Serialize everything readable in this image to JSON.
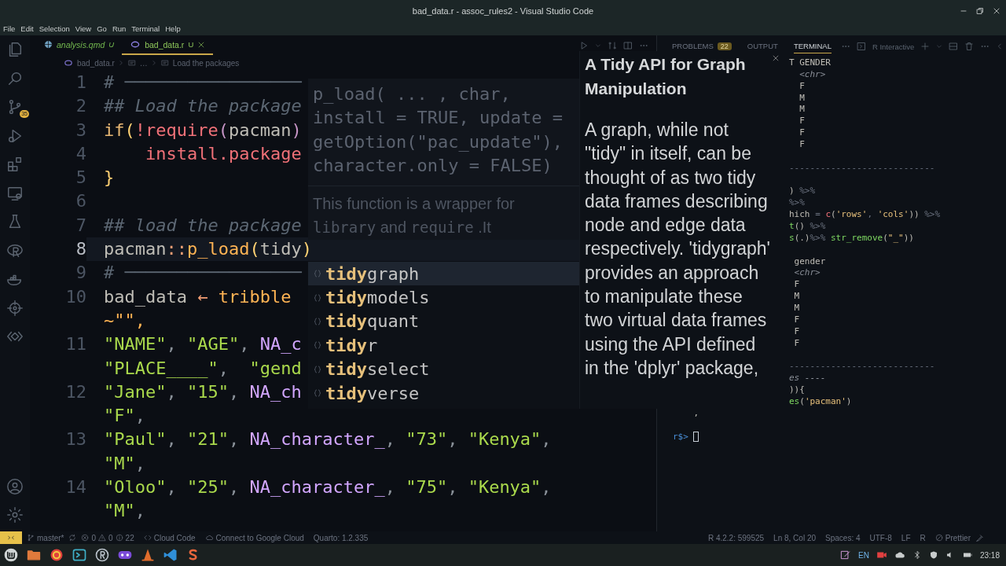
{
  "window": {
    "title": "bad_data.r - assoc_rules2 - Visual Studio Code"
  },
  "menu": [
    "File",
    "Edit",
    "Selection",
    "View",
    "Go",
    "Run",
    "Terminal",
    "Help"
  ],
  "activity_bar": {
    "badge": "35"
  },
  "editor": {
    "tabs": [
      {
        "label": "analysis.qmd",
        "status": "U",
        "selected": false
      },
      {
        "label": "bad_data.r",
        "status": "U",
        "selected": true
      }
    ],
    "breadcrumb": [
      "bad_data.r",
      "…",
      "Load the packages"
    ],
    "lines": [
      {
        "number": "1",
        "current": false,
        "rows": [
          {
            "kind": "code",
            "tokens": [
              {
                "text": "# ─────────────────",
                "kind": "comment"
              }
            ]
          }
        ]
      },
      {
        "number": "2",
        "current": false,
        "rows": [
          {
            "kind": "code",
            "tokens": [
              {
                "text": "## Load the package",
                "kind": "comment"
              }
            ]
          }
        ]
      },
      {
        "number": "3",
        "current": false,
        "rows": [
          {
            "kind": "code",
            "tokens": [
              {
                "text": "if",
                "kind": "keyword"
              },
              {
                "text": "(",
                "kind": "paren"
              },
              {
                "text": "!require",
                "kind": "call"
              },
              {
                "text": "(",
                "kind": "paren2"
              },
              {
                "text": "pacman",
                "kind": "plain"
              },
              {
                "text": ")",
                "kind": "paren2"
              }
            ]
          }
        ]
      },
      {
        "number": "4",
        "current": false,
        "rows": [
          {
            "kind": "code",
            "tokens": [
              {
                "text": "    install.package",
                "kind": "call"
              }
            ]
          }
        ]
      },
      {
        "number": "5",
        "current": false,
        "rows": [
          {
            "kind": "code",
            "tokens": [
              {
                "text": "}",
                "kind": "paren"
              }
            ]
          }
        ]
      },
      {
        "number": "6",
        "current": false,
        "rows": [
          {
            "kind": "blank"
          }
        ]
      },
      {
        "number": "7",
        "current": false,
        "rows": [
          {
            "kind": "code",
            "tokens": [
              {
                "text": "## load the package",
                "kind": "comment"
              }
            ]
          }
        ]
      },
      {
        "number": "8",
        "current": true,
        "rows": [
          {
            "kind": "code",
            "tokens": [
              {
                "text": "pacman",
                "kind": "plain"
              },
              {
                "text": "::",
                "kind": "op"
              },
              {
                "text": "p_load",
                "kind": "fn"
              },
              {
                "text": "(",
                "kind": "paren"
              },
              {
                "text": "tidy",
                "kind": "plain"
              },
              {
                "text": ")",
                "kind": "paren"
              }
            ]
          }
        ]
      },
      {
        "number": "9",
        "current": false,
        "rows": [
          {
            "kind": "code",
            "tokens": [
              {
                "text": "# ─────────────────",
                "kind": "comment"
              }
            ]
          }
        ]
      },
      {
        "number": "10",
        "current": false,
        "rows": [
          {
            "kind": "code",
            "tokens": [
              {
                "text": "bad_data ",
                "kind": "plain"
              },
              {
                "text": "←",
                "kind": "op"
              },
              {
                "text": " tribble",
                "kind": "fn"
              }
            ]
          },
          {
            "kind": "code",
            "tokens": [
              {
                "text": "~\"\",",
                "kind": "fn"
              }
            ]
          }
        ]
      },
      {
        "number": "11",
        "current": false,
        "rows": [
          {
            "kind": "code",
            "tokens": [
              {
                "text": "\"NAME\"",
                "kind": "string"
              },
              {
                "text": ", ",
                "kind": "punct"
              },
              {
                "text": "\"AGE\"",
                "kind": "string"
              },
              {
                "text": ", ",
                "kind": "punct"
              },
              {
                "text": "NA_c",
                "kind": "na"
              }
            ]
          },
          {
            "kind": "code",
            "tokens": [
              {
                "text": "\"PLACE____\"",
                "kind": "string"
              },
              {
                "text": ",  ",
                "kind": "punct"
              },
              {
                "text": "\"gend",
                "kind": "string"
              }
            ]
          }
        ]
      },
      {
        "number": "12",
        "current": false,
        "rows": [
          {
            "kind": "code",
            "tokens": [
              {
                "text": "\"Jane\"",
                "kind": "string"
              },
              {
                "text": ", ",
                "kind": "punct"
              },
              {
                "text": "\"15\"",
                "kind": "string"
              },
              {
                "text": ", ",
                "kind": "punct"
              },
              {
                "text": "NA_ch",
                "kind": "na"
              }
            ]
          },
          {
            "kind": "code",
            "tokens": [
              {
                "text": "\"F\"",
                "kind": "string"
              },
              {
                "text": ",",
                "kind": "punct"
              }
            ]
          }
        ]
      },
      {
        "number": "13",
        "current": false,
        "rows": [
          {
            "kind": "code",
            "tokens": [
              {
                "text": "\"Paul\"",
                "kind": "string"
              },
              {
                "text": ", ",
                "kind": "punct"
              },
              {
                "text": "\"21\"",
                "kind": "string"
              },
              {
                "text": ", ",
                "kind": "punct"
              },
              {
                "text": "NA_character_",
                "kind": "na"
              },
              {
                "text": ", ",
                "kind": "punct"
              },
              {
                "text": "\"73\"",
                "kind": "string"
              },
              {
                "text": ", ",
                "kind": "punct"
              },
              {
                "text": "\"Kenya\"",
                "kind": "string"
              },
              {
                "text": ",",
                "kind": "punct"
              }
            ]
          },
          {
            "kind": "code",
            "tokens": [
              {
                "text": "\"M\"",
                "kind": "string"
              },
              {
                "text": ",",
                "kind": "punct"
              }
            ]
          }
        ]
      },
      {
        "number": "14",
        "current": false,
        "rows": [
          {
            "kind": "code",
            "tokens": [
              {
                "text": "\"Oloo\"",
                "kind": "string"
              },
              {
                "text": ", ",
                "kind": "punct"
              },
              {
                "text": "\"25\"",
                "kind": "string"
              },
              {
                "text": ", ",
                "kind": "punct"
              },
              {
                "text": "NA_character_",
                "kind": "na"
              },
              {
                "text": ", ",
                "kind": "punct"
              },
              {
                "text": "\"75\"",
                "kind": "string"
              },
              {
                "text": ", ",
                "kind": "punct"
              },
              {
                "text": "\"Kenya\"",
                "kind": "string"
              },
              {
                "text": ",",
                "kind": "punct"
              }
            ]
          },
          {
            "kind": "code",
            "tokens": [
              {
                "text": "\"M\"",
                "kind": "string"
              },
              {
                "text": ",",
                "kind": "punct"
              }
            ]
          }
        ]
      }
    ]
  },
  "hover": {
    "signature": [
      "p_load( ... , char,",
      "install = TRUE, update =",
      "getOption(\"pac_update\"),",
      "character.only = FALSE)"
    ],
    "description": [
      {
        "text": "This function is a wrapper for ",
        "kind": "text"
      },
      {
        "text": "library",
        "kind": "code"
      },
      {
        "text": " and ",
        "kind": "text"
      },
      {
        "text": "require",
        "kind": "code"
      },
      {
        "text": " .It",
        "kind": "text"
      }
    ]
  },
  "suggestions": [
    {
      "match": "tidy",
      "rest": "graph",
      "selected": true
    },
    {
      "match": "tidy",
      "rest": "models",
      "selected": false
    },
    {
      "match": "tidy",
      "rest": "quant",
      "selected": false
    },
    {
      "match": "tidy",
      "rest": "r",
      "selected": false
    },
    {
      "match": "tidy",
      "rest": "select",
      "selected": false
    },
    {
      "match": "tidy",
      "rest": "verse",
      "selected": false
    }
  ],
  "docs": {
    "title": "A Tidy API for Graph Manipulation",
    "body": "A graph, while not \"tidy\" in itself, can be thought of as two tidy data frames describing node and edge data respectively. 'tidygraph' provides an approach to manipulate these two virtual data frames using the API defined in the 'dplyr' package,"
  },
  "panel": {
    "tabs": [
      {
        "label": "PROBLEMS",
        "badge": "22",
        "selected": false
      },
      {
        "label": "OUTPUT",
        "selected": false
      },
      {
        "label": "TERMINAL",
        "selected": true
      }
    ],
    "terminal_name": "R Interactive",
    "output": [
      {
        "kind": "text",
        "tokens": [
          {
            "text": "T GENDER",
            "kind": "plain"
          }
        ]
      },
      {
        "kind": "text",
        "tokens": [
          {
            "text": "  <chr>",
            "kind": "italic"
          }
        ]
      },
      {
        "kind": "text",
        "tokens": [
          {
            "text": "  F",
            "kind": "plain"
          }
        ]
      },
      {
        "kind": "text",
        "tokens": [
          {
            "text": "  M",
            "kind": "plain"
          }
        ]
      },
      {
        "kind": "text",
        "tokens": [
          {
            "text": "  M",
            "kind": "plain"
          }
        ]
      },
      {
        "kind": "text",
        "tokens": [
          {
            "text": "  F",
            "kind": "plain"
          }
        ]
      },
      {
        "kind": "text",
        "tokens": [
          {
            "text": "  F",
            "kind": "plain"
          }
        ]
      },
      {
        "kind": "text",
        "tokens": [
          {
            "text": "  F",
            "kind": "plain"
          }
        ]
      },
      {
        "kind": "blank"
      },
      {
        "kind": "text",
        "tokens": [
          {
            "text": "----------------------------",
            "kind": "dim"
          }
        ]
      },
      {
        "kind": "blank"
      },
      {
        "kind": "text",
        "tokens": [
          {
            "text": ") ",
            "kind": "plain"
          },
          {
            "text": "%>%",
            "kind": "dim"
          }
        ]
      },
      {
        "kind": "text",
        "tokens": [
          {
            "text": "%>%",
            "kind": "dim"
          }
        ]
      },
      {
        "kind": "text",
        "tokens": [
          {
            "text": "hich ",
            "kind": "plain"
          },
          {
            "text": "= ",
            "kind": "dim"
          },
          {
            "text": "c",
            "kind": "call"
          },
          {
            "text": "(",
            "kind": "plain"
          },
          {
            "text": "'rows'",
            "kind": "yellow"
          },
          {
            "text": ", ",
            "kind": "dim"
          },
          {
            "text": "'cols'",
            "kind": "yellow"
          },
          {
            "text": ")) ",
            "kind": "plain"
          },
          {
            "text": "%>%",
            "kind": "dim"
          }
        ]
      },
      {
        "kind": "text",
        "tokens": [
          {
            "text": "t",
            "kind": "green"
          },
          {
            "text": "() ",
            "kind": "plain"
          },
          {
            "text": "%>%",
            "kind": "dim"
          }
        ]
      },
      {
        "kind": "text",
        "tokens": [
          {
            "text": "s",
            "kind": "green"
          },
          {
            "text": "(.)",
            "kind": "plain"
          },
          {
            "text": "%>% ",
            "kind": "dim"
          },
          {
            "text": "str_remove",
            "kind": "green"
          },
          {
            "text": "(",
            "kind": "plain"
          },
          {
            "text": "\"_\"",
            "kind": "yellow"
          },
          {
            "text": "))",
            "kind": "plain"
          }
        ]
      },
      {
        "kind": "blank"
      },
      {
        "kind": "text",
        "tokens": [
          {
            "text": " gender",
            "kind": "plain"
          }
        ]
      },
      {
        "kind": "text",
        "tokens": [
          {
            "text": " <chr>",
            "kind": "italic"
          }
        ]
      },
      {
        "kind": "text",
        "tokens": [
          {
            "text": " F",
            "kind": "plain"
          }
        ]
      },
      {
        "kind": "text",
        "tokens": [
          {
            "text": " M",
            "kind": "plain"
          }
        ]
      },
      {
        "kind": "text",
        "tokens": [
          {
            "text": " M",
            "kind": "plain"
          }
        ]
      },
      {
        "kind": "text",
        "tokens": [
          {
            "text": " F",
            "kind": "plain"
          }
        ]
      },
      {
        "kind": "text",
        "tokens": [
          {
            "text": " F",
            "kind": "plain"
          }
        ]
      },
      {
        "kind": "text",
        "tokens": [
          {
            "text": " F",
            "kind": "plain"
          }
        ]
      },
      {
        "kind": "blank"
      },
      {
        "kind": "text",
        "tokens": [
          {
            "text": "----------------------------",
            "kind": "dim"
          }
        ]
      },
      {
        "kind": "text",
        "tokens": [
          {
            "text": "es ----",
            "kind": "italic"
          }
        ]
      },
      {
        "kind": "text",
        "tokens": [
          {
            "text": ")){",
            "kind": "plain"
          }
        ]
      },
      {
        "kind": "text",
        "tokens": [
          {
            "text": "es",
            "kind": "green"
          },
          {
            "text": "(",
            "kind": "plain"
          },
          {
            "text": "'pacman'",
            "kind": "yellow"
          },
          {
            "text": ")",
            "kind": "plain"
          }
        ]
      }
    ],
    "tail": [
      {
        "kind": "text",
        "tokens": [
          {
            "text": "    ,",
            "kind": "plain"
          }
        ]
      },
      {
        "kind": "blank"
      }
    ],
    "prompt": "r$>"
  },
  "status_bar": {
    "branch": "master*",
    "errors": "0",
    "warnings": "0",
    "infos": "22",
    "left": [
      {
        "text": "Cloud Code",
        "kind": "code"
      },
      {
        "text": "Connect to Google Cloud",
        "kind": "cloud"
      },
      {
        "text": "Quarto: 1.2.335",
        "kind": "plain"
      }
    ],
    "right": [
      {
        "text": "R 4.2.2: 599525",
        "kind": "plain"
      },
      {
        "text": "Ln 8, Col 20",
        "kind": "plain"
      },
      {
        "text": "Spaces: 4",
        "kind": "plain"
      },
      {
        "text": "UTF-8",
        "kind": "plain"
      },
      {
        "text": "LF",
        "kind": "plain"
      },
      {
        "text": "R",
        "kind": "plain"
      },
      {
        "text": "Prettier",
        "kind": "blocked"
      }
    ]
  },
  "taskbar": {
    "language": "EN",
    "time": "23:18"
  }
}
